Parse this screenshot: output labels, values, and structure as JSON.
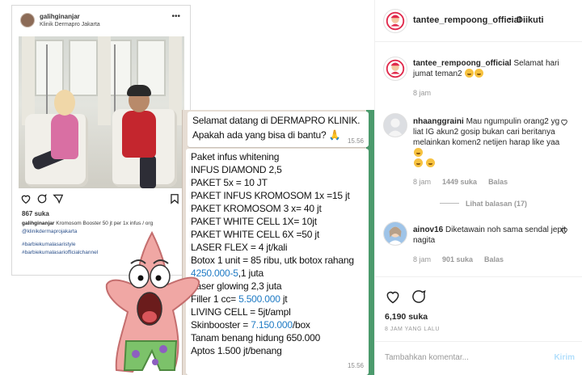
{
  "post": {
    "author": "tantee_rempoong_official",
    "dot": "•",
    "follow_label": "Diikuti",
    "likes": "6,190 suka",
    "time_ago": "8 JAM YANG LALU",
    "comment_placeholder": "Tambahkan komentar...",
    "send_label": "Kirim"
  },
  "caption": {
    "user": "tantee_rempoong_official",
    "text": " Selamat hari jumat teman2",
    "time": "8 jam"
  },
  "comments": [
    {
      "user": "nhaanggraini",
      "text": " Mau ngumpulin orang2 yg liat IG akun2 gosip bukan cari beritanya melainkan komen2 netijen harap like yaa",
      "time": "8 jam",
      "likes": "1449 suka",
      "reply": "Balas"
    },
    {
      "user": "ainov16",
      "text": " Diketawain noh sama sendal jepit nagita",
      "time": "8 jam",
      "likes": "901 suka",
      "reply": "Balas"
    }
  ],
  "view_replies": "Lihat balasan (17)",
  "embedded_post": {
    "username": "galihginanjar",
    "location": "Klinik Dermapro Jakarta",
    "more": "•••",
    "likes": "867 suka",
    "caption_user": "galihginanjar",
    "caption_text": " Kromosom Booster 50 jt per 1x infus / org",
    "mention": "@klinikdermaprojakarta",
    "hashtag_1": "#barbiekumalasaristyle",
    "hashtag_2": "#barbiekumalasariofficialchannel"
  },
  "chat": {
    "bubble1_line1": "Selamat datang di DERMAPRO KLINIK.",
    "bubble1_line2": "Apakah ada yang bisa di bantu? 🙏",
    "bubble1_time": "15.56",
    "lines": [
      "Paket infus whitening",
      "INFUS DIAMOND 2,5",
      "PAKET 5x = 10 JT",
      "PAKET INFUS KROMOSOM 1x =15 jt",
      "PAKET KROMOSOM 3 x= 40 jt",
      "PAKET WHITE CELL 1X= 10jt",
      "PAKET WHITE CELL 6X =50 jt",
      "LASER FLEX = 4 jt/kali",
      "Botox 1 unit = 85 ribu, utk botox rahang"
    ],
    "line_botox_blue": "4250.000-5",
    "line_botox_rest": ",1 juta",
    "line_laser": "Laser glowing 2,3 juta",
    "line_filler_pre": "Filler 1 cc= ",
    "line_filler_blue": "5.500.000",
    "line_filler_post": " jt",
    "line_living": "LIVING CELL = 5jt/ampl",
    "line_skin_pre": "Skinbooster = ",
    "line_skin_blue": "7.150.000",
    "line_skin_post": "/box",
    "line_tanam": "Tanam benang hidung 650.000",
    "line_aptos": "Aptos 1.500 jt/benang",
    "bubble2_time": "15.56"
  },
  "colors": {
    "link_blue": "#1e7ac4",
    "chat_bg": "#e6ddd4",
    "send_blue": "#b2dffc"
  }
}
